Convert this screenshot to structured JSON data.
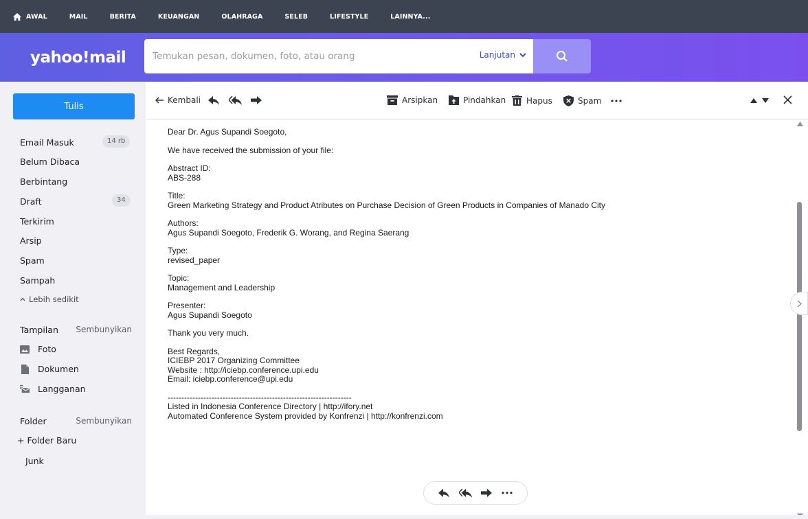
{
  "topnav": {
    "items": [
      {
        "label": "AWAL"
      },
      {
        "label": "MAIL"
      },
      {
        "label": "BERITA"
      },
      {
        "label": "KEUANGAN"
      },
      {
        "label": "OLAHRAGA"
      },
      {
        "label": "SELEB"
      },
      {
        "label": "LIFESTYLE"
      },
      {
        "label": "LAINNYA..."
      }
    ]
  },
  "header": {
    "logo": "yahoo!mail",
    "search_placeholder": "Temukan pesan, dokumen, foto, atau orang",
    "advanced_label": "Lanjutan"
  },
  "sidebar": {
    "compose_label": "Tulis",
    "folders": [
      {
        "label": "Email Masuk",
        "count": "14 rb"
      },
      {
        "label": "Belum Dibaca"
      },
      {
        "label": "Berbintang"
      },
      {
        "label": "Draft",
        "count": "34"
      },
      {
        "label": "Terkirim"
      },
      {
        "label": "Arsip"
      },
      {
        "label": "Spam"
      },
      {
        "label": "Sampah"
      }
    ],
    "less_label": "Lebih sedikit",
    "views_title": "Tampilan",
    "views_hide": "Sembunyikan",
    "views": [
      {
        "label": "Foto",
        "icon": "photo-icon"
      },
      {
        "label": "Dokumen",
        "icon": "document-icon"
      },
      {
        "label": "Langganan",
        "icon": "subscription-icon"
      }
    ],
    "folder_title": "Folder",
    "folder_hide": "Sembunyikan",
    "new_folder": "+ Folder Baru",
    "custom_folders": [
      {
        "label": "Junk"
      }
    ]
  },
  "toolbar": {
    "back_label": "Kembali",
    "archive_label": "Arsipkan",
    "move_label": "Pindahkan",
    "delete_label": "Hapus",
    "spam_label": "Spam"
  },
  "message": {
    "paragraphs": [
      "Dear Dr. Agus Supandi Soegoto,",
      "We have received the submission of your file:",
      "Abstract ID:\nABS-288",
      "Title:\nGreen Marketing Strategy and Product Atributes on Purchase Decision of Green Products in Companies of Manado City",
      "Authors:\nAgus Supandi Soegoto, Frederik G. Worang, and Regina Saerang",
      "Type:\nrevised_paper",
      "Topic:\nManagement and Leadership",
      "Presenter:\nAgus Supandi Soegoto",
      "Thank you very much.",
      "Best Regards,\nICIEBP 2017 Organizing Committee\nWebsite : http://iciebp.conference.upi.edu\nEmail: iciebp.conference@upi.edu",
      "-------------------------------------------------------------------\nListed in Indonesia Conference Directory | http://ifory.net\nAutomated Conference System provided by Konfrenzi | http://konfrenzi.com"
    ]
  }
}
